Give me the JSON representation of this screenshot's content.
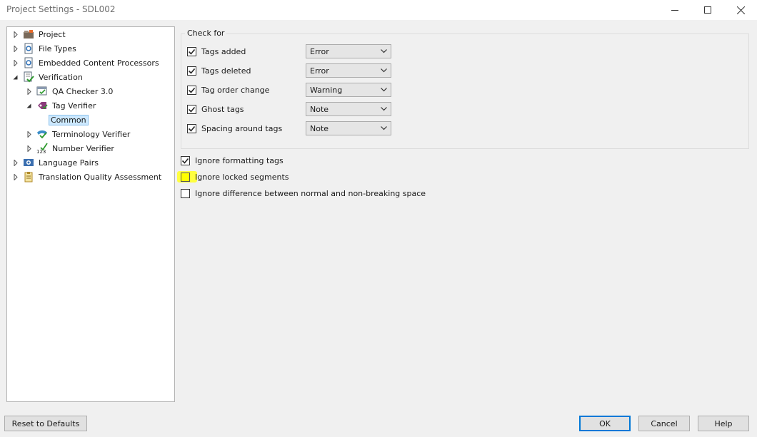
{
  "window": {
    "title": "Project Settings - SDL002"
  },
  "tree": {
    "items": [
      {
        "label": "Project",
        "icon": "project-icon",
        "expander": "collapsed",
        "level": 0
      },
      {
        "label": "File Types",
        "icon": "file-types-icon",
        "expander": "collapsed",
        "level": 0
      },
      {
        "label": "Embedded Content Processors",
        "icon": "embedded-content-icon",
        "expander": "collapsed",
        "level": 0
      },
      {
        "label": "Verification",
        "icon": "verification-icon",
        "expander": "expanded",
        "level": 0
      },
      {
        "label": "QA Checker 3.0",
        "icon": "qa-checker-icon",
        "expander": "collapsed",
        "level": 1
      },
      {
        "label": "Tag Verifier",
        "icon": "tag-verifier-icon",
        "expander": "expanded",
        "level": 1
      },
      {
        "label": "Common",
        "icon": "",
        "expander": "none",
        "level": 2,
        "selected": true
      },
      {
        "label": "Terminology Verifier",
        "icon": "terminology-verifier-icon",
        "expander": "collapsed",
        "level": 1
      },
      {
        "label": "Number Verifier",
        "icon": "number-verifier-icon",
        "expander": "collapsed",
        "level": 1
      },
      {
        "label": "Language Pairs",
        "icon": "language-pairs-icon",
        "expander": "collapsed",
        "level": 0
      },
      {
        "label": "Translation Quality Assessment",
        "icon": "tqa-icon",
        "expander": "collapsed",
        "level": 0
      }
    ]
  },
  "check_for": {
    "title": "Check for",
    "rows": [
      {
        "label": "Tags added",
        "checked": true,
        "severity": "Error"
      },
      {
        "label": "Tags deleted",
        "checked": true,
        "severity": "Error"
      },
      {
        "label": "Tag order change",
        "checked": true,
        "severity": "Warning"
      },
      {
        "label": "Ghost tags",
        "checked": true,
        "severity": "Note"
      },
      {
        "label": "Spacing around tags",
        "checked": true,
        "severity": "Note"
      }
    ]
  },
  "options": [
    {
      "label": "Ignore formatting tags",
      "checked": true
    },
    {
      "label": "Ignore locked segments",
      "checked": false,
      "highlighted": true
    },
    {
      "label": "Ignore difference between normal and non-breaking space",
      "checked": false
    }
  ],
  "buttons": {
    "reset": "Reset to Defaults",
    "ok": "OK",
    "cancel": "Cancel",
    "help": "Help"
  },
  "colors": {
    "highlight": "#ffff00",
    "selection": "#cce8ff",
    "default_button_border": "#0078d7"
  }
}
